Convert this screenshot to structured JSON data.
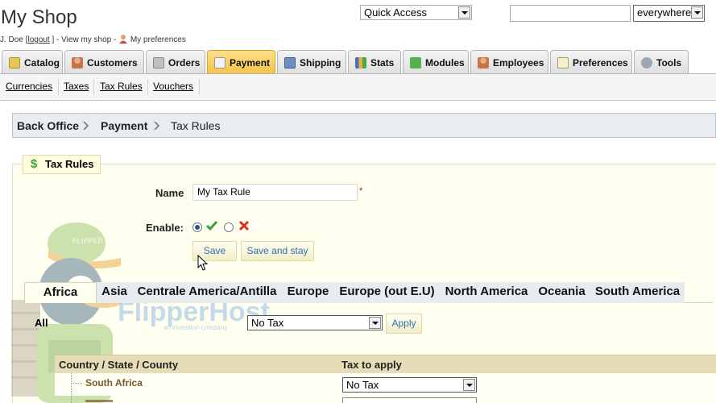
{
  "header": {
    "shop_title": "My Shop",
    "user_prefix": "J. Doe [",
    "logout_label": "logout",
    "user_mid": "] - View my shop -",
    "preferences_label": "My preferences",
    "quick_access": "Quick Access",
    "search_value": "",
    "search_scope": "everywhere"
  },
  "tabs": [
    {
      "label": "Catalog",
      "icon": "folder-icon",
      "color": "#e8b93a"
    },
    {
      "label": "Customers",
      "icon": "user-icon",
      "color": "#c9734a"
    },
    {
      "label": "Orders",
      "icon": "cart-icon",
      "color": "#8c8c8c"
    },
    {
      "label": "Payment",
      "icon": "payment-icon",
      "color": "#d84a3a"
    },
    {
      "label": "Shipping",
      "icon": "truck-icon",
      "color": "#5a7fb0"
    },
    {
      "label": "Stats",
      "icon": "stats-icon",
      "color": "#4a6fc0"
    },
    {
      "label": "Modules",
      "icon": "puzzle-icon",
      "color": "#4aa84a"
    },
    {
      "label": "Employees",
      "icon": "employee-icon",
      "color": "#c9734a"
    },
    {
      "label": "Preferences",
      "icon": "preferences-icon",
      "color": "#a0a060"
    },
    {
      "label": "Tools",
      "icon": "wrench-icon",
      "color": "#7a8a9a"
    }
  ],
  "subnav": [
    "Currencies",
    "Taxes",
    "Tax Rules",
    "Vouchers"
  ],
  "breadcrumb": [
    "Back Office",
    "Payment",
    "Tax Rules"
  ],
  "form": {
    "legend": "Tax Rules",
    "name_label": "Name",
    "name_value": "My Tax Rule",
    "required_mark": "*",
    "enable_label": "Enable:",
    "enabled": true,
    "save_label": "Save",
    "save_stay_label": "Save and stay"
  },
  "zones": [
    "Africa",
    "Asia",
    "Centrale America/Antilla",
    "Europe",
    "Europe (out E.U)",
    "North America",
    "Oceania",
    "South America"
  ],
  "active_zone": "Africa",
  "all_row": {
    "label": "All",
    "select_value": "No Tax",
    "apply_label": "Apply"
  },
  "table": {
    "col_country": "Country / State / County",
    "col_tax": "Tax to apply",
    "rows": [
      {
        "country": "South Africa",
        "tax": "No Tax"
      }
    ]
  },
  "watermark": {
    "brand": "FlipperHost",
    "tagline": "an investlion company",
    "cap_text": "FLIPPER HOST"
  },
  "colors": {
    "active_tab": "#f6c345",
    "link": "#2f6fb5",
    "check_green": "#3aa236",
    "cross_red": "#d93025"
  }
}
